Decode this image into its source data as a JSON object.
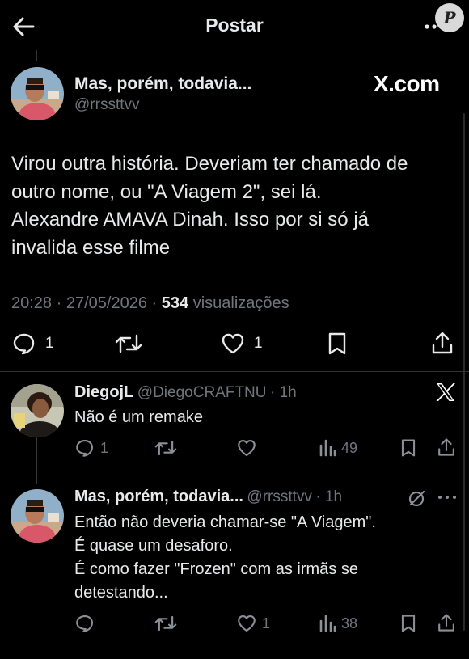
{
  "header": {
    "title": "Postar"
  },
  "watermark": "P",
  "main_post": {
    "name": "Mas, porém, todavia...",
    "handle": "@rrssttvv",
    "brand": "X.com",
    "text_lines": [
      "Virou outra história. Deveriam ter chamado de",
      "outro nome, ou \"A Viagem 2\", sei lá.",
      "Alexandre AMAVA Dinah. Isso por si só já",
      "invalida esse filme"
    ],
    "time": "20:28",
    "sep1": "·",
    "date": "27/05/2026",
    "sep2": "·",
    "views_count": "534",
    "views_label": "visualizações",
    "replies": "1",
    "likes": "1"
  },
  "reply1": {
    "name": "DiegojL",
    "handle": "@DiegoCRAFTNU",
    "time": "· 1h",
    "text": "Não é um remake",
    "replies": "1",
    "views": "49"
  },
  "reply2": {
    "name": "Mas, porém, todavia...",
    "handle": "@rrssttvv",
    "time": "· 1h",
    "text_lines": [
      "Então não deveria chamar-se \"A Viagem\".",
      "É quase um desaforo.",
      "É como fazer \"Frozen\" com as irmãs se",
      "detestando..."
    ],
    "likes": "1",
    "views": "38"
  },
  "colors": {
    "background": "#000000",
    "text": "#e7e9ea",
    "muted": "#71767b",
    "divider": "#2f3336"
  },
  "icons": [
    "back-arrow-icon",
    "more-icon",
    "reply-icon",
    "retweet-icon",
    "heart-icon",
    "bookmark-icon",
    "share-icon",
    "views-icon",
    "x-logo-icon",
    "grok-icon"
  ]
}
